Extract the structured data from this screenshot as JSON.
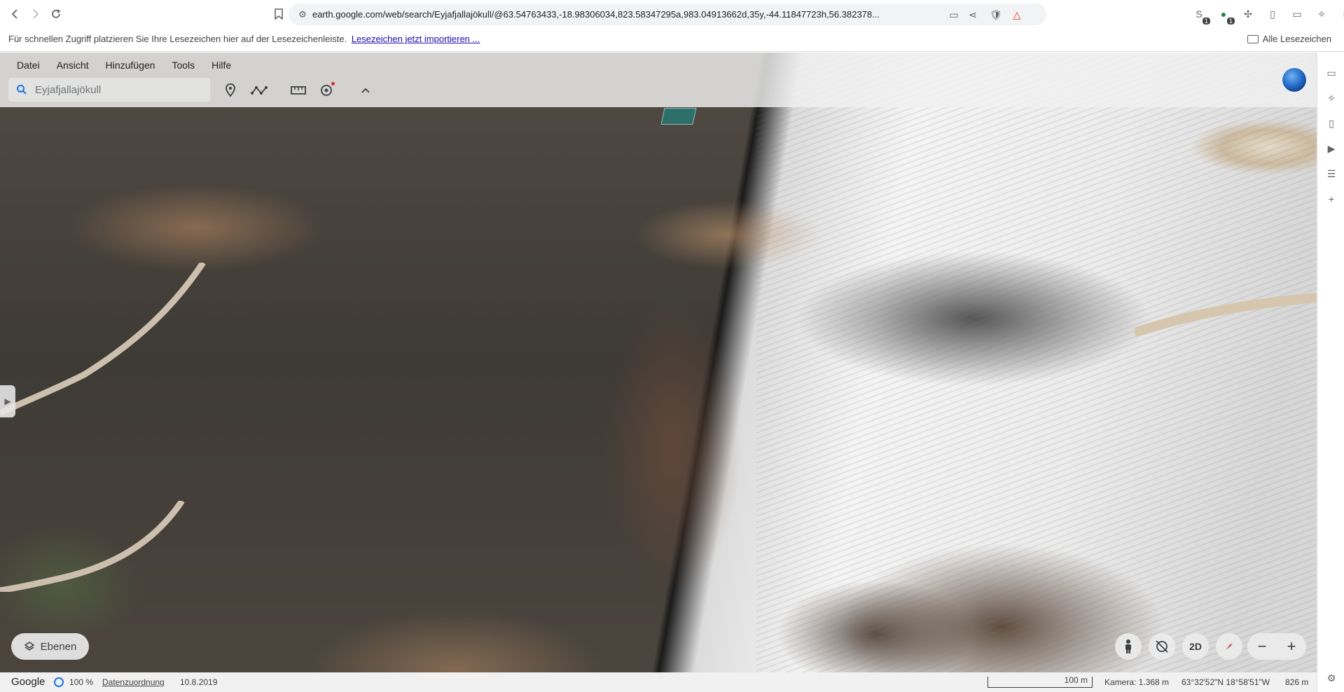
{
  "browser": {
    "url": "earth.google.com/web/search/Eyjafjallajökull/@63.54763433,-18.98306034,823.58347295a,983.04913662d,35y,-44.11847723h,56.382378...",
    "bookmark_hint": "Für schnellen Zugriff platzieren Sie Ihre Lesezeichen hier auf der Lesezeichenleiste.",
    "bookmark_hint_link": "Lesezeichen jetzt importieren ...",
    "all_bookmarks": "Alle Lesezeichen",
    "extension_badges": [
      "1",
      "1"
    ]
  },
  "menu": [
    "Datei",
    "Ansicht",
    "Hinzufügen",
    "Tools",
    "Hilfe"
  ],
  "search": {
    "value": "Eyjafjallajökull"
  },
  "layers_label": "Ebenen",
  "controls": {
    "mode_2d": "2D",
    "zoom_out": "−",
    "zoom_in": "+"
  },
  "status": {
    "brand": "Google",
    "zoom_percent": "100 %",
    "attribution": "Datenzuordnung",
    "date": "10.8.2019",
    "scale": "100 m",
    "camera": "Kamera: 1.368 m",
    "coords": "63°32'52\"N 18°58'51\"W",
    "elevation": "826 m"
  },
  "colors": {
    "accent": "#1a73e8",
    "glacier": "#ececec",
    "terrain": "#4a443c"
  }
}
